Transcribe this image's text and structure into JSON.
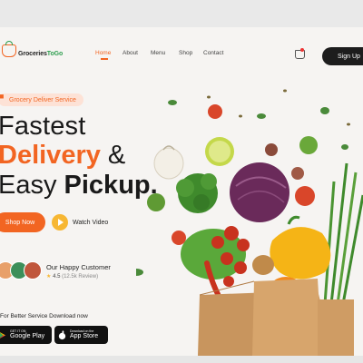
{
  "brand": {
    "name_part1": "Groceries",
    "name_part2": "ToGo"
  },
  "nav": {
    "items": [
      {
        "label": "Home",
        "active": true
      },
      {
        "label": "About",
        "active": false
      },
      {
        "label": "Menu",
        "active": false
      },
      {
        "label": "Shop",
        "active": false
      },
      {
        "label": "Contact",
        "active": false
      }
    ],
    "signup_label": "Sign Up"
  },
  "hero": {
    "tagline": "Grocery Deliver Service",
    "headline_line1": "Fastest",
    "headline_delivery": "Delivery",
    "headline_amp": " &",
    "headline_easy": "Easy ",
    "headline_pickup": "Pickup.",
    "shop_label": "Shop Now",
    "video_label": "Watch Video"
  },
  "customers": {
    "title": "Our Happy Customer",
    "rating": "4.5",
    "reviews": "(12.5k Review)",
    "avatar_colors": [
      "#e8a06a",
      "#3c8f5a",
      "#c0563c"
    ]
  },
  "download": {
    "text": "For Better Service Download now",
    "google_small": "GET IT ON",
    "google_big": "Google Play",
    "apple_small": "Download on the",
    "apple_big": "App Store"
  },
  "colors": {
    "accent": "#f26522",
    "green": "#2e9e4f",
    "dark": "#1d1d1d",
    "yellow": "#f7b733"
  }
}
